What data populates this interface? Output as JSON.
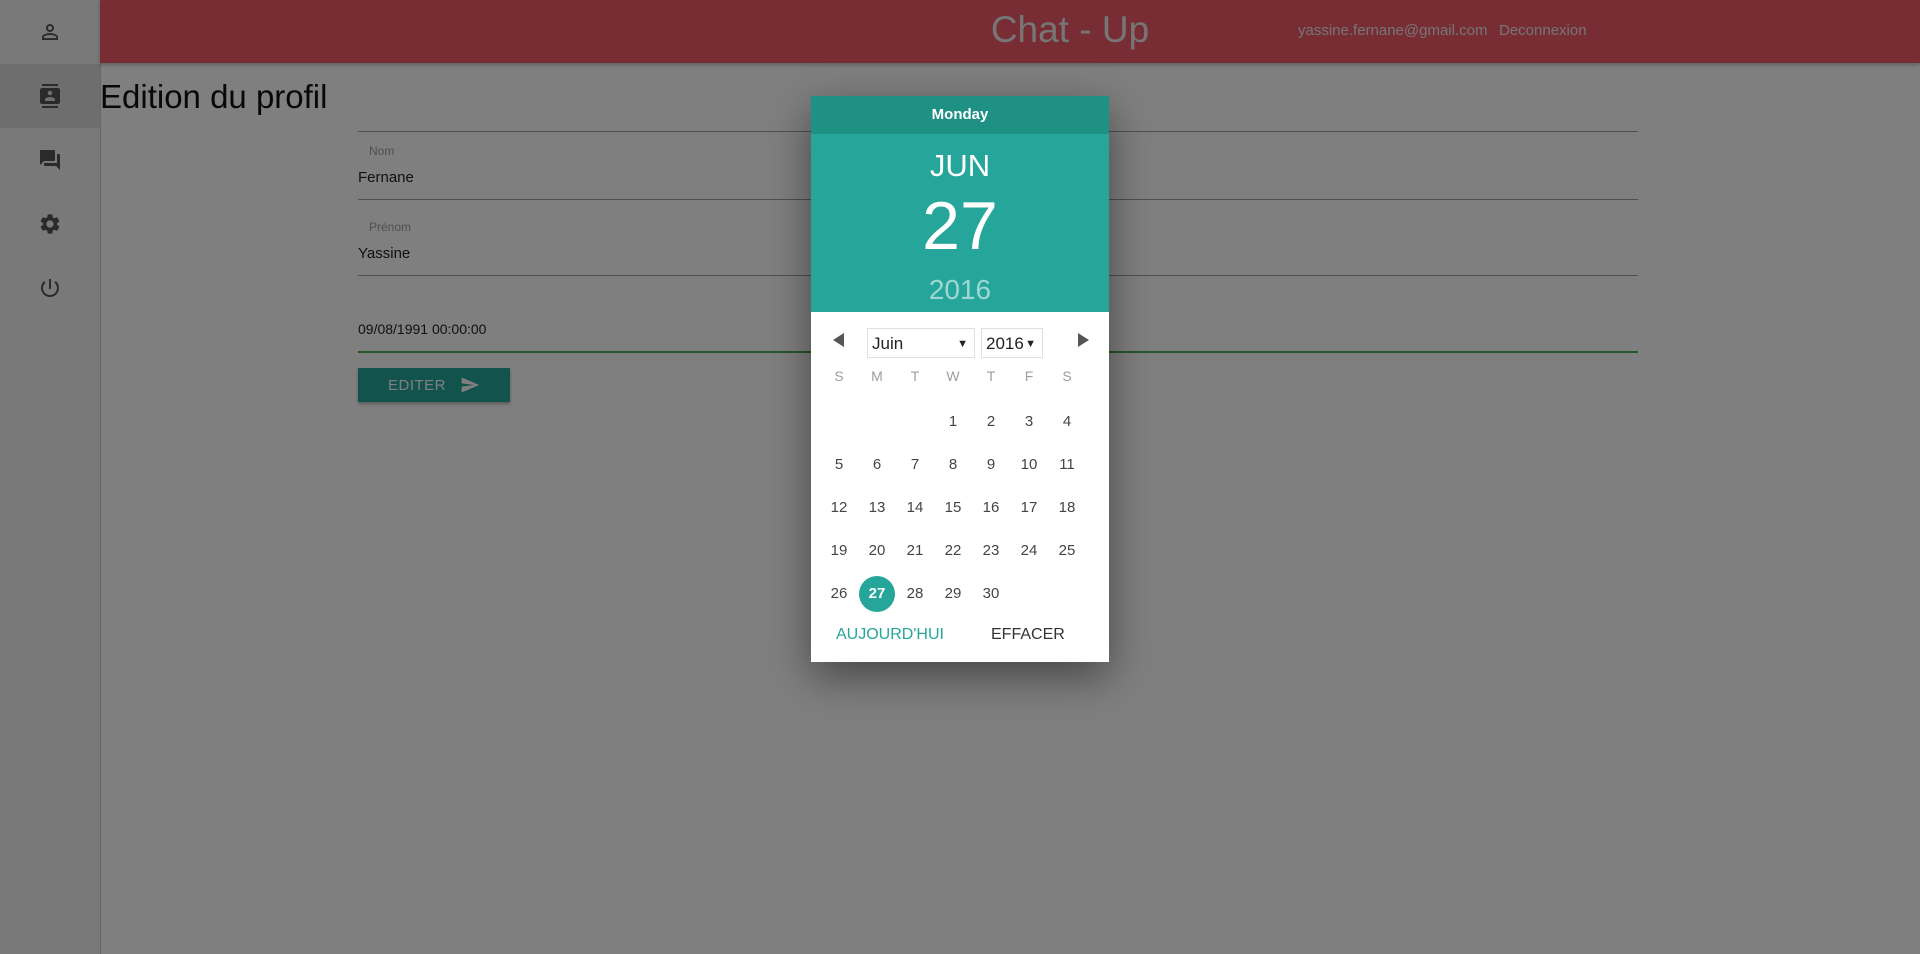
{
  "header": {
    "title": "Chat - Up",
    "user_email": "yassine.fernane@gmail.com",
    "logout": "Deconnexion",
    "color": "#ee5a67"
  },
  "sidebar": {
    "items": [
      {
        "icon": "person-icon",
        "active": false
      },
      {
        "icon": "contact-card-icon",
        "active": true
      },
      {
        "icon": "forum-icon",
        "active": false
      },
      {
        "icon": "settings-icon",
        "active": false
      },
      {
        "icon": "power-icon",
        "active": false
      }
    ]
  },
  "profile_form": {
    "title": "Edition du profil",
    "last_name_label": "Nom",
    "last_name_value": "Fernane",
    "first_name_label": "Prénom",
    "first_name_value": "Yassine",
    "birthdate_value": "09/08/1991 00:00:00",
    "submit_label": "EDITER",
    "submit_icon": "send-icon",
    "accent": "#26a69a"
  },
  "datepicker": {
    "weekday": "Monday",
    "month_short": "JUN",
    "day": "27",
    "year": "2016",
    "month_select": "Juin",
    "year_select": "2016",
    "day_headers": [
      "S",
      "M",
      "T",
      "W",
      "T",
      "F",
      "S"
    ],
    "weeks": [
      [
        "",
        "",
        "",
        "1",
        "2",
        "3",
        "4"
      ],
      [
        "5",
        "6",
        "7",
        "8",
        "9",
        "10",
        "11"
      ],
      [
        "12",
        "13",
        "14",
        "15",
        "16",
        "17",
        "18"
      ],
      [
        "19",
        "20",
        "21",
        "22",
        "23",
        "24",
        "25"
      ],
      [
        "26",
        "27",
        "28",
        "29",
        "30",
        "",
        ""
      ]
    ],
    "selected_day": "27",
    "today_label": "AUJOURD'HUI",
    "clear_label": "EFFACER",
    "header_color": "#26a69a",
    "weekday_bar_color": "#1f9084"
  }
}
